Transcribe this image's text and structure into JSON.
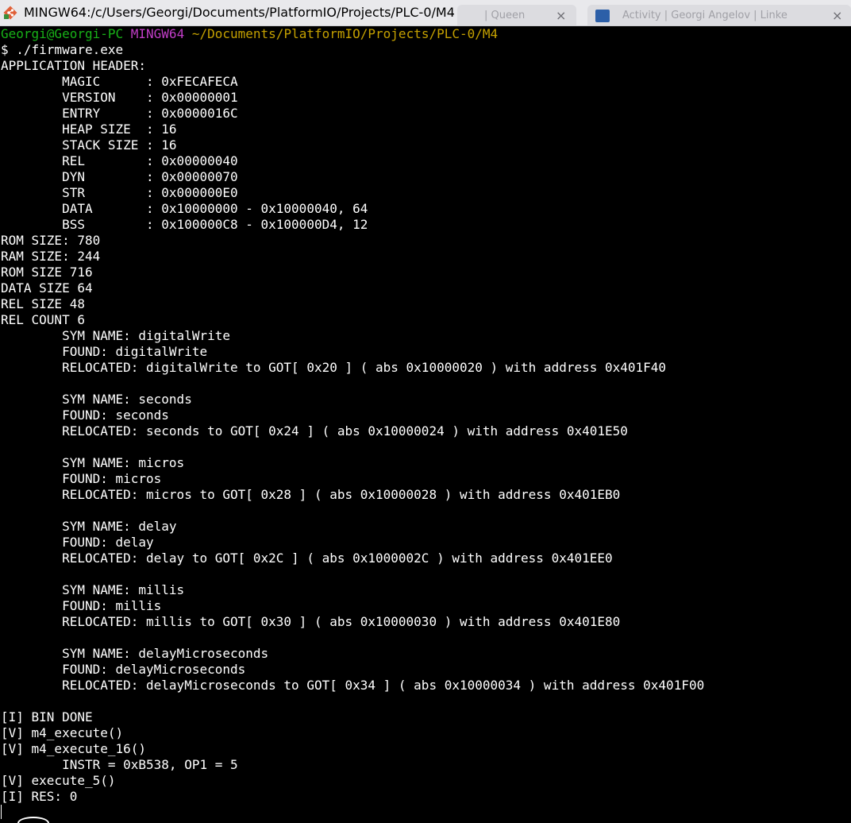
{
  "window": {
    "title": "MINGW64:/c/Users/Georgi/Documents/PlatformIO/Projects/PLC-0/M4",
    "background_tabs": [
      {
        "label": "| Queen",
        "close": "×"
      },
      {
        "label": "Activity | Georgi Angelov | Linke",
        "close": "×"
      }
    ]
  },
  "colors": {
    "prompt_user": "#18b218",
    "prompt_shell": "#c03dc6",
    "prompt_path": "#c4a000",
    "text": "#ffffff",
    "background": "#000000"
  },
  "prompt": {
    "user": "Georgi@Georgi-PC",
    "shell": "MINGW64",
    "path": "~/Documents/PlatformIO/Projects/PLC-0/M4",
    "command": "$ ./firmware.exe"
  },
  "output_lines": [
    "APPLICATION HEADER:",
    "        MAGIC      : 0xFECAFECA",
    "        VERSION    : 0x00000001",
    "        ENTRY      : 0x0000016C",
    "        HEAP SIZE  : 16",
    "        STACK SIZE : 16",
    "        REL        : 0x00000040",
    "        DYN        : 0x00000070",
    "        STR        : 0x000000E0",
    "        DATA       : 0x10000000 - 0x10000040, 64",
    "        BSS        : 0x100000C8 - 0x100000D4, 12",
    "ROM SIZE: 780",
    "RAM SIZE: 244",
    "ROM SIZE 716",
    "DATA SIZE 64",
    "REL SIZE 48",
    "REL COUNT 6",
    "        SYM NAME: digitalWrite",
    "        FOUND: digitalWrite",
    "        RELOCATED: digitalWrite to GOT[ 0x20 ] ( abs 0x10000020 ) with address 0x401F40",
    "",
    "        SYM NAME: seconds",
    "        FOUND: seconds",
    "        RELOCATED: seconds to GOT[ 0x24 ] ( abs 0x10000024 ) with address 0x401E50",
    "",
    "        SYM NAME: micros",
    "        FOUND: micros",
    "        RELOCATED: micros to GOT[ 0x28 ] ( abs 0x10000028 ) with address 0x401EB0",
    "",
    "        SYM NAME: delay",
    "        FOUND: delay",
    "        RELOCATED: delay to GOT[ 0x2C ] ( abs 0x1000002C ) with address 0x401EE0",
    "",
    "        SYM NAME: millis",
    "        FOUND: millis",
    "        RELOCATED: millis to GOT[ 0x30 ] ( abs 0x10000030 ) with address 0x401E80",
    "",
    "        SYM NAME: delayMicroseconds",
    "        FOUND: delayMicroseconds",
    "        RELOCATED: delayMicroseconds to GOT[ 0x34 ] ( abs 0x10000034 ) with address 0x401F00",
    "",
    "[I] BIN DONE",
    "[V] m4_execute()",
    "[V] m4_execute_16()",
    "        INSTR = 0xB538, OP1 = 5",
    "[V] execute_5()",
    "[I] RES: 0"
  ]
}
